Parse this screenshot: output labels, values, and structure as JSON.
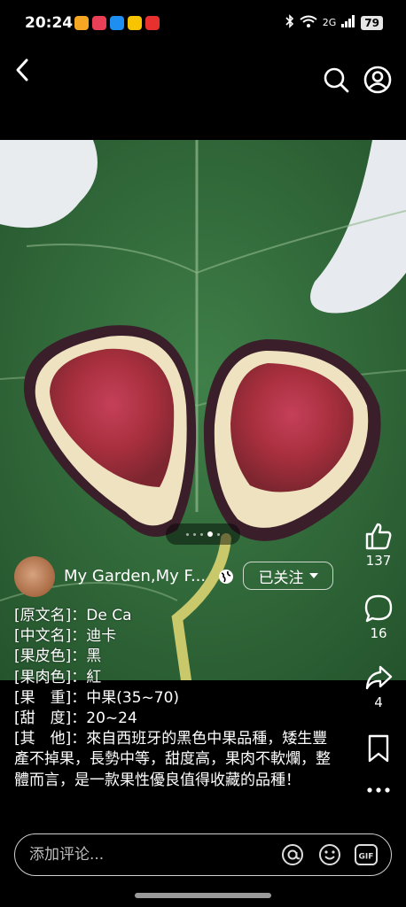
{
  "status_bar": {
    "time": "20:24",
    "network": "2G",
    "battery": "79",
    "app_icon_colors": [
      "#f5a623",
      "#e94057",
      "#1f8ef1",
      "#f8c400",
      "#e8312f"
    ]
  },
  "nav": {
    "back_icon": "chevron-left-icon",
    "search_icon": "search-icon",
    "profile_icon": "profile-icon"
  },
  "post": {
    "pager": {
      "count": 5,
      "active_index": 3
    },
    "author": {
      "name": "My Garden,My F...",
      "visibility_icon": "globe-icon",
      "follow_label": "已关注"
    },
    "caption_lines": [
      "[原文名]：De Ca",
      "[中文名]：迪卡",
      "[果皮色]：黑",
      "[果肉色]：紅",
      "[果　重]：中果(35~70)",
      "[甜　度]：20~24",
      "[其　他]：來自西班牙的黑色中果品種，矮生豐產不掉果，長勢中等，甜度高，果肉不軟爛，整體而言，是一款果性優良值得收藏的品種！"
    ]
  },
  "actions": {
    "like_count": "137",
    "comment_count": "16",
    "share_count": "4"
  },
  "comment_bar": {
    "placeholder": "添加评论...",
    "gif_label": "GIF"
  },
  "colors": {
    "background": "#000000",
    "leaf_green": "#2f6a3a",
    "fig_flesh": "#b5384a"
  }
}
